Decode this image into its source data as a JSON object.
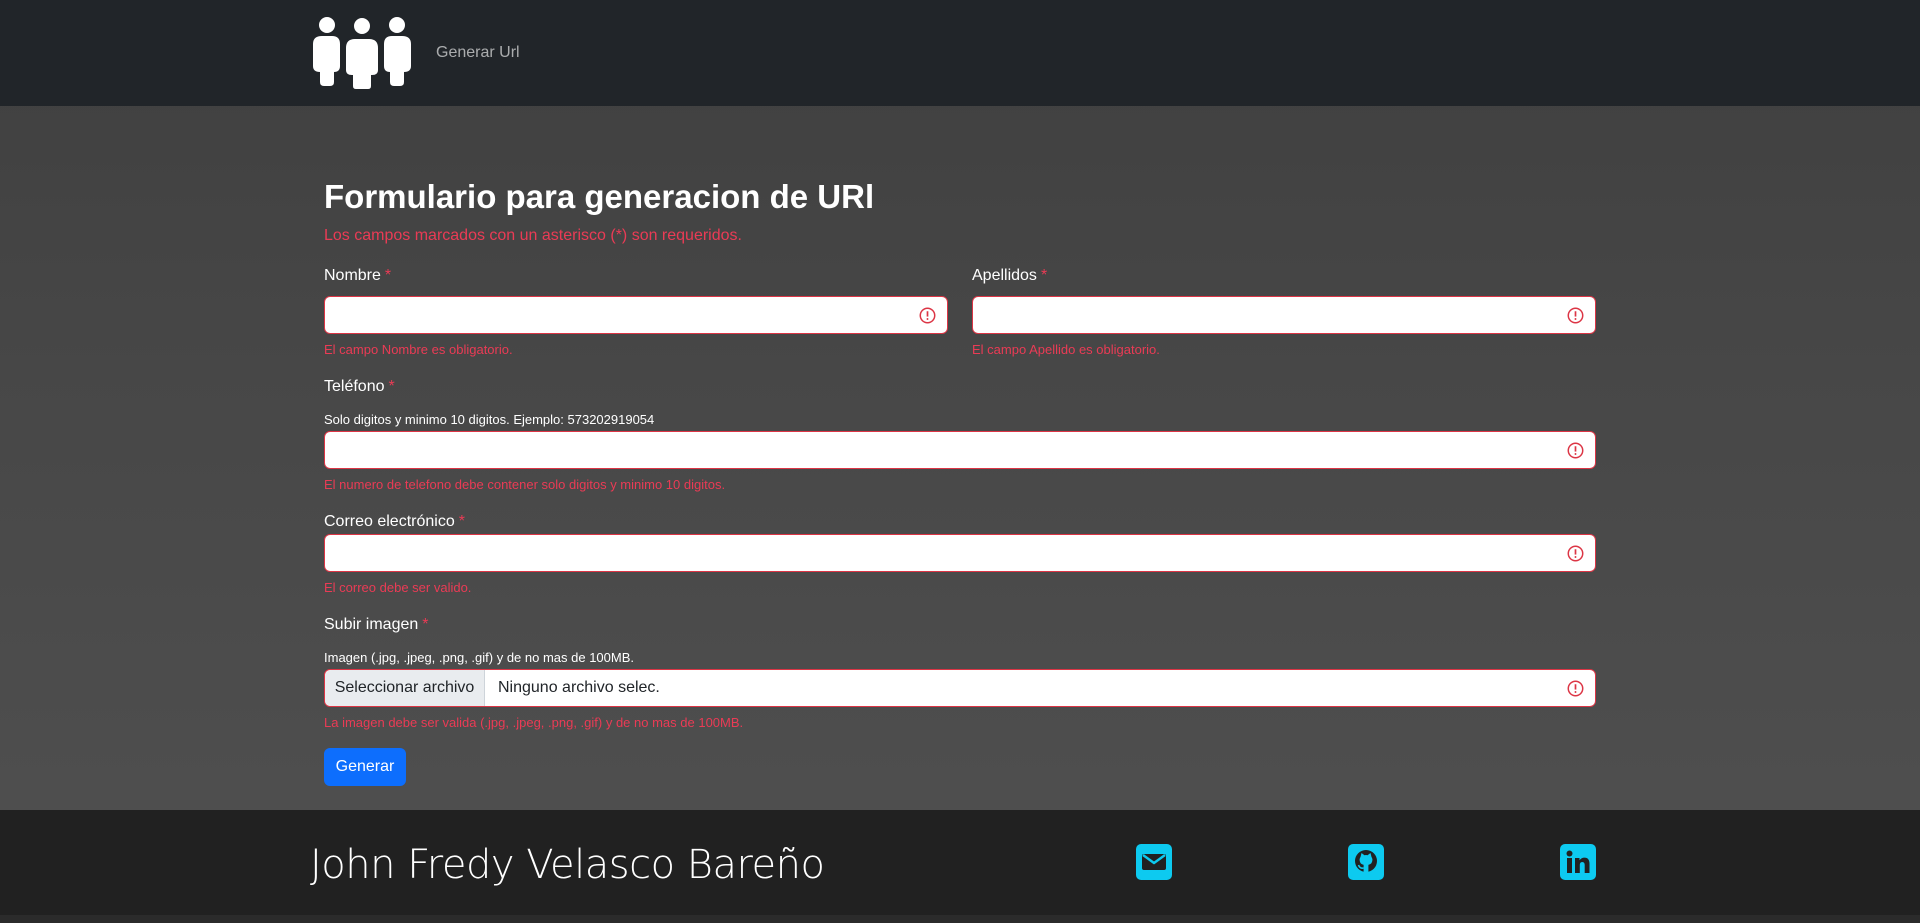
{
  "navbar": {
    "brand_icon": "people-group-icon",
    "link_label": "Generar Url"
  },
  "form": {
    "title": "Formulario para generacion de URl",
    "required_note": "Los campos marcados con un asterisco (*) son requeridos.",
    "required_mark": "*",
    "nombre": {
      "label": "Nombre",
      "error": "El campo Nombre es obligatorio.",
      "value": ""
    },
    "apellidos": {
      "label": "Apellidos",
      "error": "El campo Apellido es obligatorio.",
      "value": ""
    },
    "telefono": {
      "label": "Teléfono",
      "help": "Solo digitos y minimo 10 digitos. Ejemplo: 573202919054",
      "error": "El numero de telefono debe contener solo digitos y minimo 10 digitos.",
      "value": ""
    },
    "correo": {
      "label": "Correo electrónico",
      "error": "El correo debe ser valido.",
      "value": ""
    },
    "imagen": {
      "label": "Subir imagen",
      "help": "Imagen (.jpg, .jpeg, .png, .gif) y de no mas de 100MB.",
      "button_label": "Seleccionar archivo",
      "file_status": "Ninguno archivo selec.",
      "error": "La imagen debe ser valida (.jpg, .jpeg, .png, .gif) y de no mas de 100MB."
    },
    "submit_label": "Generar"
  },
  "footer": {
    "author": "John Fredy Velasco Bareño",
    "social": [
      {
        "name": "email-icon",
        "color": "#0dcaf0"
      },
      {
        "name": "github-icon",
        "color": "#0dcaf0"
      },
      {
        "name": "linkedin-icon",
        "color": "#0dcaf0"
      }
    ]
  },
  "colors": {
    "navbar_bg": "#212529",
    "error": "#dc3545",
    "primary": "#0d6efd",
    "social": "#0dcaf0"
  }
}
